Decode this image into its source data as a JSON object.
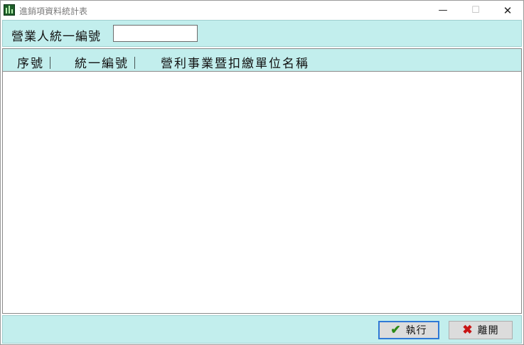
{
  "window": {
    "title": "進銷項資料統計表",
    "minimize_glyph": "—",
    "maximize_glyph": "☐",
    "close_glyph": "✕"
  },
  "form": {
    "tax_id_label": "營業人統一編號",
    "tax_id_value": ""
  },
  "list": {
    "columns": [
      "序號｜",
      "統一編號｜",
      "營利事業暨扣繳單位名稱"
    ],
    "rows": []
  },
  "buttons": {
    "execute": {
      "label": "執行",
      "icon": "check-icon"
    },
    "leave": {
      "label": "離開",
      "icon": "x-icon"
    }
  },
  "colors": {
    "panel": "#c2eeed",
    "execute_icon": "#2c8a17",
    "leave_icon": "#c81414",
    "focus_border": "#2f79d6"
  }
}
